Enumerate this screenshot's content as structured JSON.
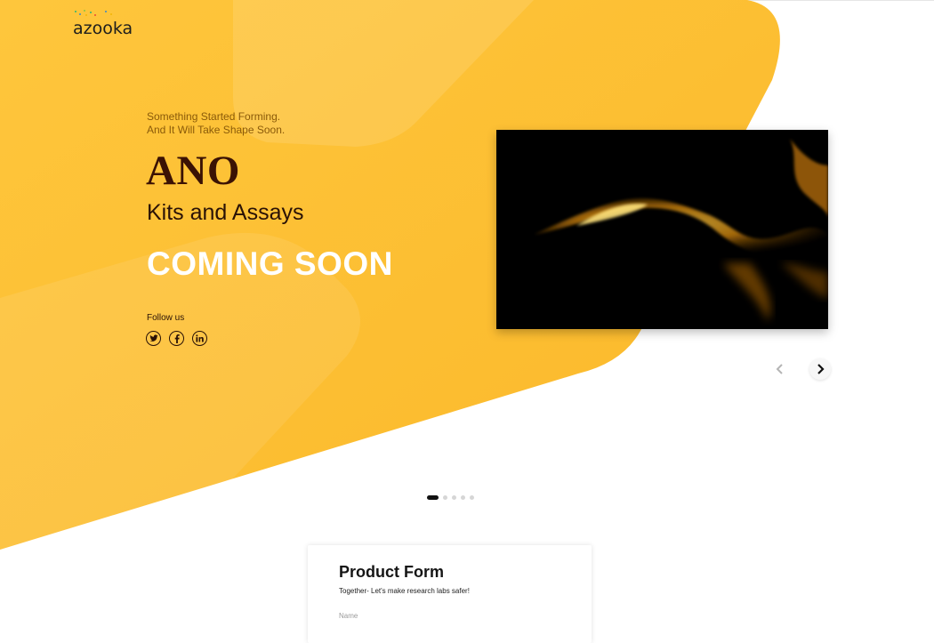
{
  "logo": {
    "text": "azooka",
    "dot_colors": [
      "#2bb673",
      "#3a86c8",
      "#f2b705",
      "#e94b35",
      "#8cc63f"
    ]
  },
  "hero": {
    "tagline": "Something Started Forming.\nAnd It Will Take Shape Soon.",
    "brand": "ANO",
    "subtitle": "Kits and Assays",
    "headline": "COMING SOON",
    "follow_label": "Follow us",
    "socials": [
      "twitter-icon",
      "facebook-icon",
      "linkedin-icon"
    ]
  },
  "carousel": {
    "prev_icon": "chevron-left-icon",
    "next_icon": "chevron-right-icon",
    "slides_total": 5,
    "active_slide": 1
  },
  "form": {
    "title": "Product Form",
    "subtitle": "Together- Let's make research labs safer!",
    "name_label": "Name"
  },
  "colors": {
    "accent": "#fbbb2e",
    "brand_dark": "#3b1204",
    "media_bg": "#000000"
  }
}
